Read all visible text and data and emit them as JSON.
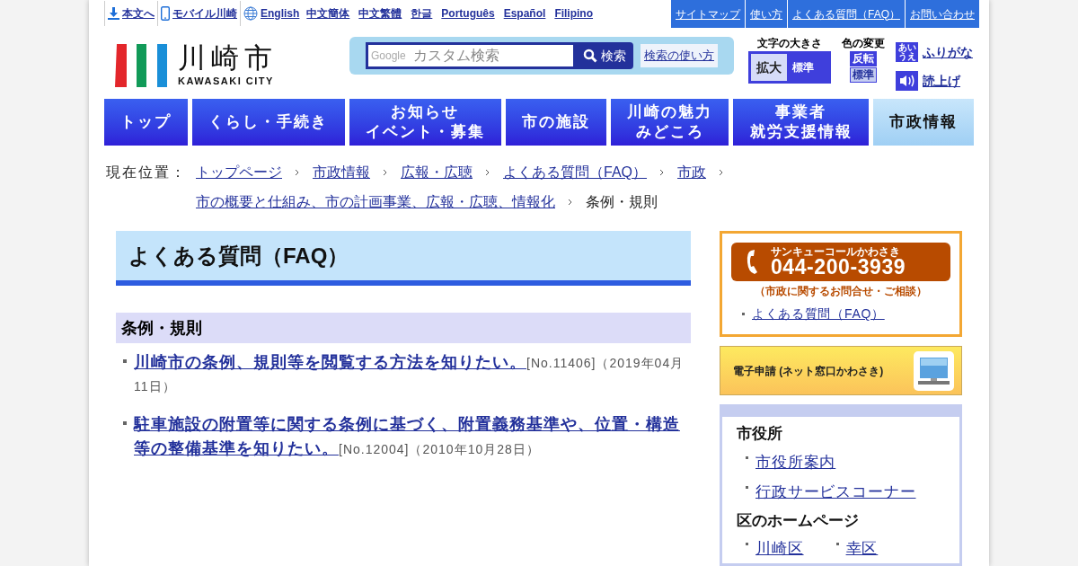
{
  "top_links": [
    {
      "label": "本文へ",
      "kind": "download"
    },
    {
      "label": "モバイル川崎",
      "kind": "mobile"
    },
    {
      "label": "English",
      "kind": "globe"
    },
    {
      "label": "中文簡体"
    },
    {
      "label": "中文繁體"
    },
    {
      "label": "한글"
    },
    {
      "label": "Português"
    },
    {
      "label": "Español"
    },
    {
      "label": "Filipino"
    }
  ],
  "utility_links": [
    "サイトマップ",
    "使い方",
    "よくある質問（FAQ）",
    "お問い合わせ"
  ],
  "logo": {
    "name": "川崎市",
    "sub": "KAWASAKI CITY"
  },
  "search": {
    "placeholder": "カスタム検索",
    "brand": "Google",
    "button": "検索",
    "help": "検索の使い方"
  },
  "font_size": {
    "title": "文字の大きさ",
    "options": [
      {
        "label": "拡大",
        "selected": true
      },
      {
        "label": "標準",
        "selected": false
      }
    ]
  },
  "color_change": {
    "title": "色の変更",
    "options": [
      "反転",
      "標準"
    ]
  },
  "tools": [
    {
      "label": "ふりがな",
      "kind": "furigana",
      "icon_lines": [
        "あい",
        "うえ"
      ]
    },
    {
      "label": "読上げ",
      "kind": "speaker"
    }
  ],
  "nav": [
    {
      "lines": [
        "トップ"
      ],
      "selected": false
    },
    {
      "lines": [
        "くらし・手続き"
      ],
      "selected": false
    },
    {
      "lines": [
        "お知らせ",
        "イベント・募集"
      ],
      "selected": false
    },
    {
      "lines": [
        "市の施設"
      ],
      "selected": false
    },
    {
      "lines": [
        "川崎の魅力",
        "みどころ"
      ],
      "selected": false
    },
    {
      "lines": [
        "事業者",
        "就労支援情報"
      ],
      "selected": false
    },
    {
      "lines": [
        "市政情報"
      ],
      "selected": true
    }
  ],
  "breadcrumb": {
    "label": "現在位置：",
    "items": [
      "トップページ",
      "市政情報",
      "広報・広聴",
      "よくある質問（FAQ）",
      "市政",
      "市の概要と仕組み、市の計画事業、広報・広聴、情報化"
    ],
    "current": "条例・規則"
  },
  "page_title": "よくある質問（FAQ）",
  "section": {
    "title": "条例・規則",
    "faqs": [
      {
        "question": "川崎市の条例、規則等を閲覧する方法を知りたい。",
        "meta": "[No.11406]（2019年04月11日）"
      },
      {
        "question": "駐車施設の附置等に関する条例に基づく、附置義務基準や、位置・構造等の整備基準を知りたい。",
        "meta": "[No.12004]（2010年10月28日）"
      }
    ]
  },
  "call_center": {
    "name": "サンキューコールかわさき",
    "phone": "044-200-3939",
    "note": "（市政に関するお問合せ・ご相談）",
    "link": "よくある質問（FAQ）"
  },
  "e_application": "電子申請 (ネット窓口かわさき)",
  "side_menu": {
    "groups": [
      {
        "title": "市役所",
        "links": [
          "市役所案内",
          "行政サービスコーナー"
        ]
      },
      {
        "title": "区のホームページ",
        "links": [
          "川崎区",
          "幸区"
        ]
      }
    ]
  }
}
